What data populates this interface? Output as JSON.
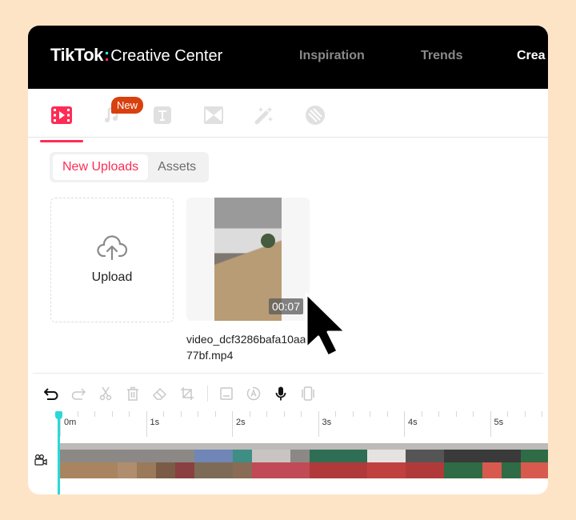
{
  "header": {
    "logo_brand": "TikTok",
    "logo_sep": ":",
    "logo_product": "Creative Center",
    "nav": [
      {
        "label": "Inspiration",
        "active": false
      },
      {
        "label": "Trends",
        "active": false
      },
      {
        "label": "Crea",
        "active": true
      }
    ]
  },
  "tool_tabs": [
    {
      "icon": "video-icon",
      "active": true
    },
    {
      "icon": "music-icon",
      "active": false,
      "badge": "New"
    },
    {
      "icon": "text-icon",
      "active": false
    },
    {
      "icon": "transition-icon",
      "active": false
    },
    {
      "icon": "effects-wand-icon",
      "active": false
    },
    {
      "icon": "sticker-icon",
      "active": false
    }
  ],
  "badge_new": "New",
  "segmented": {
    "options": [
      "New Uploads",
      "Assets"
    ],
    "selected": "New Uploads"
  },
  "upload": {
    "label": "Upload"
  },
  "media": [
    {
      "name": "video_dcf3286bafa10aa377bf.mp4",
      "duration": "00:07"
    }
  ],
  "toolbar": {
    "tools": [
      "undo",
      "redo",
      "split",
      "delete",
      "erase",
      "crop",
      "captions",
      "auto-text",
      "voiceover",
      "mask"
    ]
  },
  "timeline": {
    "labels": [
      "0m",
      "1s",
      "2s",
      "3s",
      "4s",
      "5s"
    ],
    "track": "video"
  },
  "colors": {
    "accent": "#fe2c55",
    "playhead": "#2ad8d8",
    "badge": "#d8400f",
    "background": "#fde4c6"
  }
}
